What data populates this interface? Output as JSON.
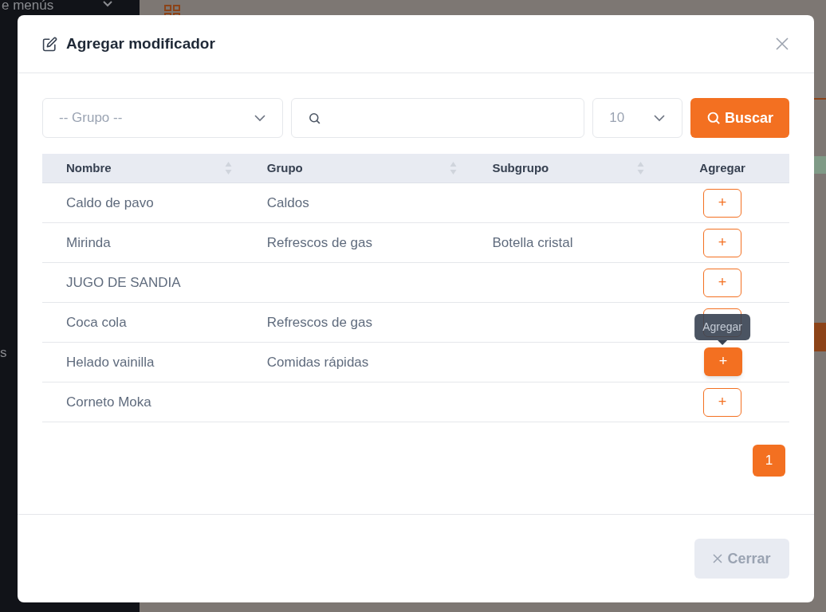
{
  "background": {
    "sidebar_items": [
      {
        "label": "e menús"
      },
      {
        "label": "s"
      }
    ]
  },
  "modal": {
    "title": "Agregar modificador",
    "filters": {
      "group_placeholder": "-- Grupo --",
      "page_size": "10",
      "search_button": "Buscar"
    },
    "table": {
      "columns": [
        {
          "label": "Nombre",
          "sortable": true
        },
        {
          "label": "Grupo",
          "sortable": true
        },
        {
          "label": "Subgrupo",
          "sortable": true
        },
        {
          "label": "Agregar",
          "sortable": false
        }
      ],
      "rows": [
        {
          "name": "Caldo de pavo",
          "group": "Caldos",
          "add": "+",
          "hovered": false
        },
        {
          "name": "Mirinda",
          "group": "Refrescos de gas",
          "subgroup": "Botella cristal",
          "add": "+",
          "hovered": false
        },
        {
          "name": "JUGO DE SANDIA",
          "add": "+",
          "hovered": false
        },
        {
          "name": "Coca cola",
          "group": "Refrescos de gas",
          "hovered": false
        },
        {
          "name": "Helado vainilla",
          "group": "Comidas rápidas",
          "add": "+",
          "hovered": true,
          "tooltip": "Agregar"
        },
        {
          "name": "Corneto Moka",
          "add": "+",
          "hovered": false
        }
      ]
    },
    "pagination": [
      {
        "label": "1",
        "selected": true
      }
    ],
    "close_button": "Cerrar"
  }
}
